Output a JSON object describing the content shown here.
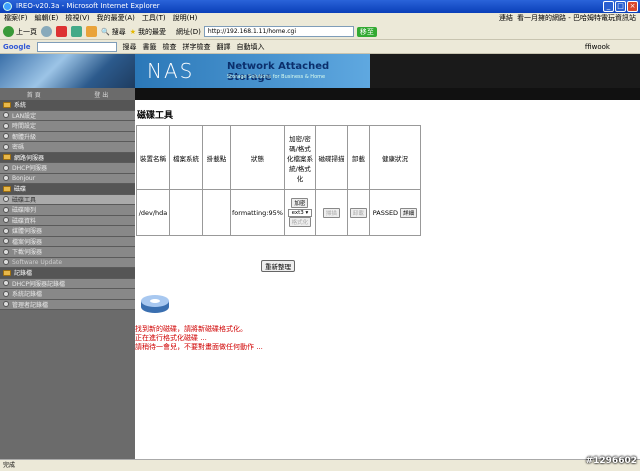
{
  "window": {
    "title": "IREO-v20.3a - Microsoft Internet Explorer"
  },
  "menu": [
    "檔案(F)",
    "編輯(E)",
    "檢視(V)",
    "我的最愛(A)",
    "工具(T)",
    "說明(H)"
  ],
  "menu_right": [
    "連結",
    "看一月擁的網路 - 巴哈姆特電玩資訊站"
  ],
  "toolbar": {
    "back": "上一頁",
    "search": "搜尋",
    "favorites": "我的最愛",
    "address_label": "網址(D)",
    "address": "http://192.168.1.11/home.cgi",
    "go": "移至"
  },
  "toolbar2": {
    "google": "Google",
    "search_btn": "搜尋",
    "bookmarks": "書籤",
    "check": "檢查",
    "spell": "拼字檢查",
    "translate": "翻譯",
    "autofill": "自動填入",
    "user": "ffiwook"
  },
  "banner": {
    "logo": "NAS",
    "title": "Network Attached Storage",
    "subtitle": "Storage Solutions for Business & Home"
  },
  "graybar": [
    "首 頁",
    "登 出"
  ],
  "sidebar": [
    {
      "label": "系統",
      "type": "cat"
    },
    {
      "label": "LAN設定",
      "type": "sub"
    },
    {
      "label": "時間設定",
      "type": "sub"
    },
    {
      "label": "韌體升級",
      "type": "sub"
    },
    {
      "label": "密碼",
      "type": "sub"
    },
    {
      "label": "網路伺服器",
      "type": "cat"
    },
    {
      "label": "DHCP伺服器",
      "type": "sub"
    },
    {
      "label": "Bonjour",
      "type": "sub"
    },
    {
      "label": "磁碟",
      "type": "cat"
    },
    {
      "label": "磁碟工具",
      "type": "active"
    },
    {
      "label": "磁碟陣列",
      "type": "sub"
    },
    {
      "label": "磁碟資料",
      "type": "sub"
    },
    {
      "label": "媒體伺服器",
      "type": "sub"
    },
    {
      "label": "檔案伺服器",
      "type": "sub"
    },
    {
      "label": "下載伺服器",
      "type": "sub"
    },
    {
      "label": "Software Update",
      "type": "dim"
    },
    {
      "label": "記錄檔",
      "type": "cat"
    },
    {
      "label": "DHCP伺服器記錄檔",
      "type": "sub"
    },
    {
      "label": "系統記錄檔",
      "type": "sub"
    },
    {
      "label": "管理者記錄檔",
      "type": "sub"
    }
  ],
  "main": {
    "title": "磁碟工具",
    "headers": [
      "裝置名稱",
      "檔案系統",
      "掛載點",
      "狀態",
      "加密/密碼/格式化檔案系統/格式化",
      "磁碟掃描",
      "卸載",
      "健康狀況"
    ],
    "row": {
      "device": "/dev/hda",
      "filesystem": "",
      "mount": "",
      "status": "formatting:95%",
      "encrypt_btn": "加密",
      "fs_select": "ext3",
      "format_btn": "格式化",
      "scan_btn": "掃描",
      "unmount_btn": "卸載",
      "health": "PASSED",
      "detail_btn": "詳細"
    },
    "refresh": "重新整理",
    "messages": [
      "找到新的磁碟，請將新磁碟格式化。",
      "正在進行格式化磁碟 ...",
      "請稍待一會兒，不要對畫面做任何動作 ..."
    ]
  },
  "statusbar": {
    "text": "完成"
  },
  "watermark": "#1296602"
}
